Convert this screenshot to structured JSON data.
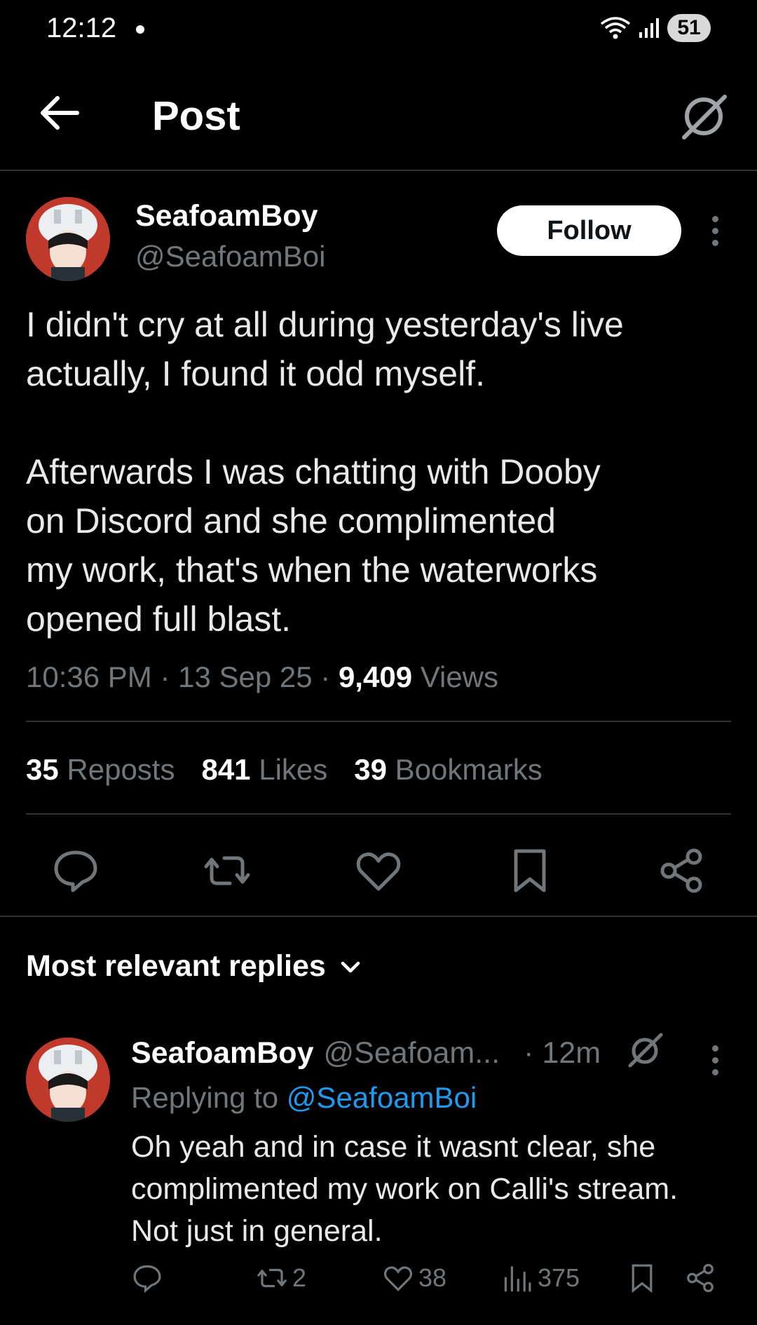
{
  "status_bar": {
    "time": "12:12",
    "battery": "51"
  },
  "header": {
    "title": "Post"
  },
  "post": {
    "author_name": "SeafoamBoy",
    "author_handle": "@SeafoamBoi",
    "follow_label": "Follow",
    "paragraphs": [
      "I didn't cry at all during yesterday's live\nactually, I found it odd myself.",
      "Afterwards I was chatting with Dooby\non Discord and she complimented\nmy work, that's when the waterworks\nopened full blast."
    ],
    "time": "10:36 PM",
    "date": "13 Sep 25",
    "views_count": "9,409",
    "views_label": "Views",
    "stats": {
      "reposts_count": "35",
      "reposts_label": "Reposts",
      "likes_count": "841",
      "likes_label": "Likes",
      "bookmarks_count": "39",
      "bookmarks_label": "Bookmarks"
    }
  },
  "replies": {
    "sort_label": "Most relevant replies",
    "items": [
      {
        "author_name": "SeafoamBoy",
        "author_handle": "@Seafoam...",
        "time": "· 12m",
        "replying_prefix": "Replying to",
        "replying_to": "@SeafoamBoi",
        "text": "Oh yeah and in case it wasnt clear, she\ncomplimented my work on Calli's stream.\nNot just in general.",
        "reposts": "2",
        "likes": "38",
        "views": "375"
      }
    ]
  },
  "colors": {
    "background": "#000000",
    "text": "#e7e9ea",
    "muted": "#71767b",
    "link": "#1d9bf0",
    "divider": "#2f3336",
    "avatar_bg": "#c0392b"
  },
  "icons": [
    "back-arrow-icon",
    "grok-icon",
    "more-icon",
    "reply-icon",
    "repost-icon",
    "like-icon",
    "bookmark-icon",
    "share-icon",
    "chevron-down-icon",
    "views-icon",
    "wifi-icon",
    "signal-icon"
  ]
}
